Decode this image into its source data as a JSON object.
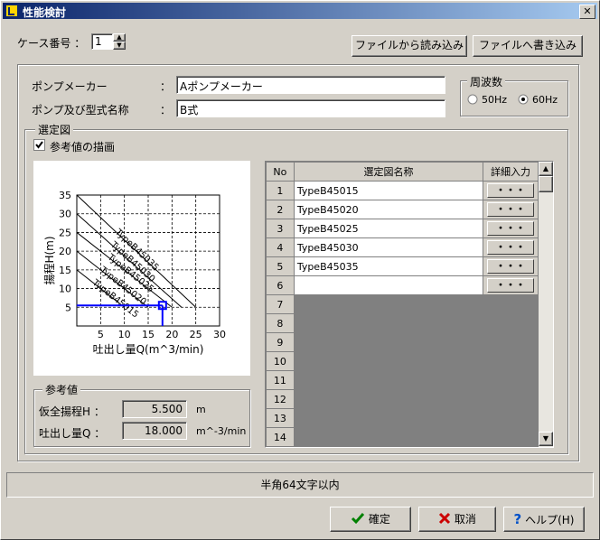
{
  "window": {
    "title": "性能検討",
    "close_label": "✕"
  },
  "case": {
    "label": "ケース番号 ：",
    "value": "1"
  },
  "file_buttons": {
    "load": "ファイルから読み込み",
    "save": "ファイルへ書き込み"
  },
  "pump": {
    "maker_label": "ポンプメーカー",
    "maker_colon": "：",
    "maker_value": "Aポンプメーカー",
    "model_label": "ポンプ及び型式名称",
    "model_colon": "：",
    "model_value": "B式"
  },
  "frequency": {
    "label": "周波数",
    "opt50": "50Hz",
    "opt60": "60Hz",
    "selected": "60Hz"
  },
  "selection": {
    "group_label": "選定図",
    "checkbox_label": "参考値の描画",
    "checkbox_checked": true
  },
  "chart_data": {
    "type": "line",
    "xlabel": "吐出し量Q(m^3/min)",
    "ylabel": "揚程H(m)",
    "xlim": [
      0,
      30
    ],
    "ylim": [
      0,
      35
    ],
    "xticks": [
      "5",
      "10",
      "15",
      "20",
      "25",
      "30"
    ],
    "yticks": [
      "5",
      "10",
      "15",
      "20",
      "25",
      "30",
      "35"
    ],
    "grid": true,
    "series": [
      {
        "name": "TypeB45015",
        "points": [
          [
            0,
            15
          ],
          [
            10,
            5
          ]
        ]
      },
      {
        "name": "TypeB45020",
        "points": [
          [
            0,
            20
          ],
          [
            15,
            5
          ]
        ]
      },
      {
        "name": "TypeB45025",
        "points": [
          [
            0,
            25
          ],
          [
            20,
            5
          ]
        ]
      },
      {
        "name": "TypeB45030",
        "points": [
          [
            0,
            30
          ],
          [
            22,
            5
          ]
        ]
      },
      {
        "name": "TypeB45035",
        "points": [
          [
            0,
            35
          ],
          [
            25,
            5
          ]
        ]
      }
    ],
    "reference_point": {
      "x": 18.0,
      "y": 5.5
    }
  },
  "reference": {
    "group_label": "参考値",
    "head_label": "仮全揚程H ：",
    "head_value": "5.500",
    "head_unit": "m",
    "flow_label": "吐出し量Q ：",
    "flow_value": "18.000",
    "flow_unit": "m^-3/min"
  },
  "table": {
    "headers": [
      "No",
      "選定図名称",
      "詳細入力"
    ],
    "detail_label": "・・・",
    "rows": [
      {
        "no": "1",
        "name": "TypeB45015",
        "active": true
      },
      {
        "no": "2",
        "name": "TypeB45020",
        "active": true
      },
      {
        "no": "3",
        "name": "TypeB45025",
        "active": true
      },
      {
        "no": "4",
        "name": "TypeB45030",
        "active": true
      },
      {
        "no": "5",
        "name": "TypeB45035",
        "active": true
      },
      {
        "no": "6",
        "name": "",
        "active": true
      },
      {
        "no": "7",
        "name": "",
        "active": false
      },
      {
        "no": "8",
        "name": "",
        "active": false
      },
      {
        "no": "9",
        "name": "",
        "active": false
      },
      {
        "no": "10",
        "name": "",
        "active": false
      },
      {
        "no": "11",
        "name": "",
        "active": false
      },
      {
        "no": "12",
        "name": "",
        "active": false
      },
      {
        "no": "13",
        "name": "",
        "active": false
      },
      {
        "no": "14",
        "name": "",
        "active": false
      }
    ]
  },
  "status": {
    "text": "半角64文字以内"
  },
  "footer": {
    "ok": "確定",
    "cancel": "取消",
    "help": "ヘルプ(H)"
  },
  "colors": {
    "title_start": "#0a246a",
    "title_end": "#a6caf0",
    "plot_blue": "#0000ff",
    "gray_row": "#808080"
  }
}
